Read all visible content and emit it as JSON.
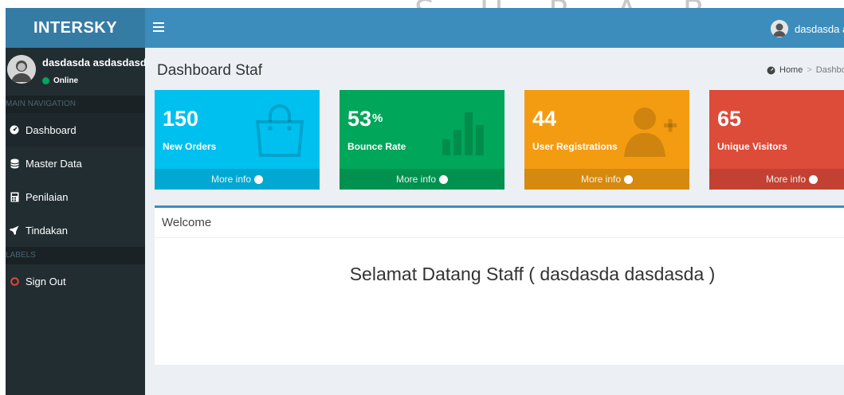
{
  "watermark": "S U R A B A Y A",
  "header": {
    "logo": "INTERSKY",
    "toggle_icon": "menu-icon",
    "user_name": "dasdasda asdasdasd"
  },
  "sidebar": {
    "user_name": "dasdasda asdasdasd",
    "status": "Online",
    "nav_header": "MAIN NAVIGATION",
    "items": [
      {
        "label": "Dashboard",
        "icon": "dashboard-icon",
        "active": true
      },
      {
        "label": "Master Data",
        "icon": "database-icon"
      },
      {
        "label": "Penilaian",
        "icon": "calculator-icon"
      },
      {
        "label": "Tindakan",
        "icon": "rocket-icon"
      }
    ],
    "labels_header": "LABELS",
    "sign_out": "Sign Out"
  },
  "content": {
    "title": "Dashboard Staf",
    "breadcrumb": [
      "Home",
      "Dashboard"
    ],
    "boxes": [
      {
        "value": "150",
        "suffix": "",
        "label": "New Orders",
        "more": "More info",
        "color": "#00c0ef",
        "icon": "shopping-bag-icon"
      },
      {
        "value": "53",
        "suffix": "%",
        "label": "Bounce Rate",
        "more": "More info",
        "color": "#00a65a",
        "icon": "bar-chart-icon"
      },
      {
        "value": "44",
        "suffix": "",
        "label": "User Registrations",
        "more": "More info",
        "color": "#f39c12",
        "icon": "user-add-icon"
      },
      {
        "value": "65",
        "suffix": "",
        "label": "Unique Visitors",
        "more": "More info",
        "color": "#dd4b39",
        "icon": "pie-chart-icon"
      }
    ],
    "panel": {
      "title": "Welcome",
      "message": "Selamat Datang Staff ( dasdasda dasdasda )"
    }
  }
}
